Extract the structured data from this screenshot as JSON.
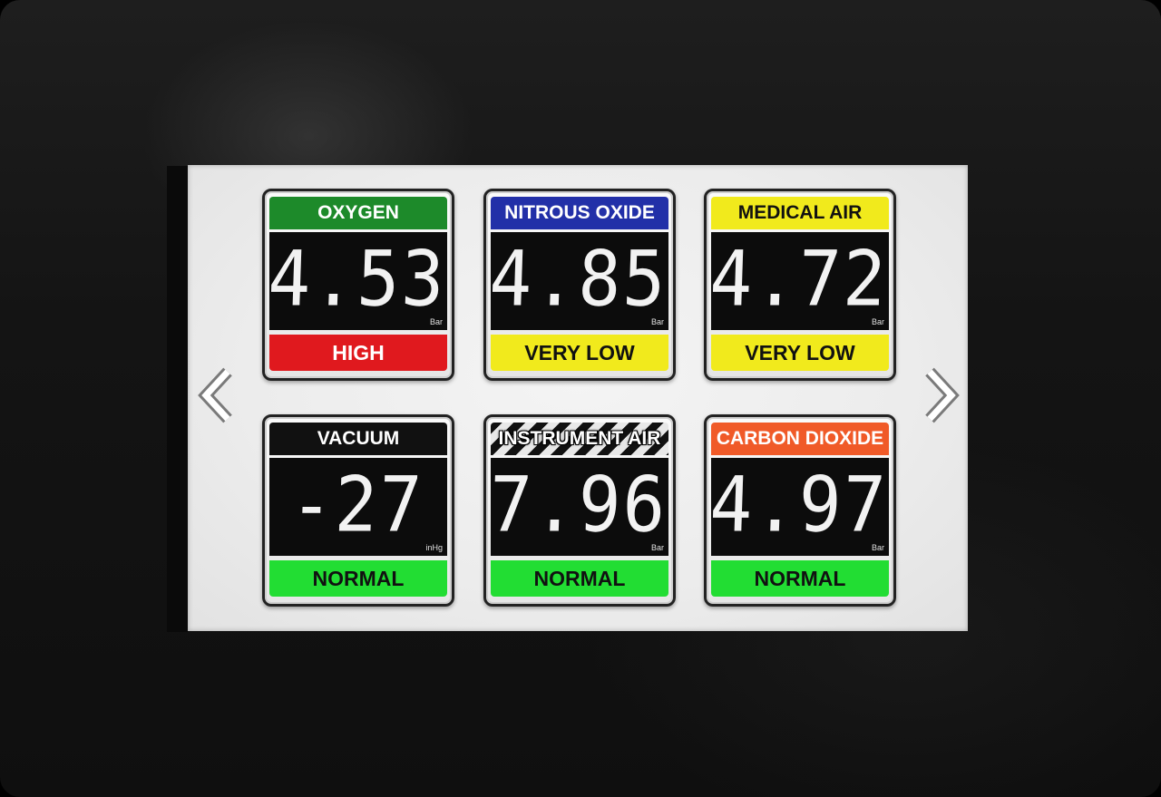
{
  "navigation": {
    "prev_icon": "chevron-left-icon",
    "next_icon": "chevron-right-icon"
  },
  "gases": [
    {
      "name": "OXYGEN",
      "value": "4.53",
      "unit": "Bar",
      "status": "HIGH",
      "header_bg": "#1d8a2a",
      "header_fg": "#ffffff",
      "status_bg": "#e0191e",
      "status_fg": "#ffffff",
      "header_style": "solid"
    },
    {
      "name": "NITROUS OXIDE",
      "value": "4.85",
      "unit": "Bar",
      "status": "VERY LOW",
      "header_bg": "#2230a8",
      "header_fg": "#ffffff",
      "status_bg": "#f1ea1c",
      "status_fg": "#111111",
      "header_style": "solid"
    },
    {
      "name": "MEDICAL AIR",
      "value": "4.72",
      "unit": "Bar",
      "status": "VERY LOW",
      "header_bg": "#f1ea1c",
      "header_fg": "#111111",
      "status_bg": "#f1ea1c",
      "status_fg": "#111111",
      "header_style": "solid"
    },
    {
      "name": "VACUUM",
      "value": "-27",
      "unit": "inHg",
      "status": "NORMAL",
      "header_bg": "#111111",
      "header_fg": "#ffffff",
      "status_bg": "#22dd33",
      "status_fg": "#111111",
      "header_style": "solid"
    },
    {
      "name": "INSTRUMENT AIR",
      "value": "7.96",
      "unit": "Bar",
      "status": "NORMAL",
      "header_bg": "#111111",
      "header_fg": "#ffffff",
      "status_bg": "#22dd33",
      "status_fg": "#111111",
      "header_style": "striped"
    },
    {
      "name": "CARBON DIOXIDE",
      "value": "4.97",
      "unit": "Bar",
      "status": "NORMAL",
      "header_bg": "#f05a28",
      "header_fg": "#ffffff",
      "status_bg": "#22dd33",
      "status_fg": "#111111",
      "header_style": "solid"
    }
  ]
}
